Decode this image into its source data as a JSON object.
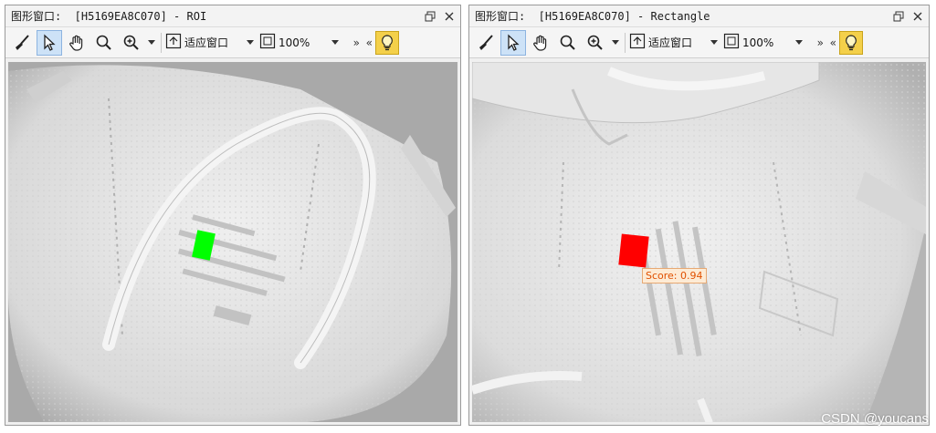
{
  "windows": [
    {
      "title": "图形窗口:  [H5169EA8C070] - ROI",
      "toolbar": {
        "fit_label": "适应窗口",
        "zoom_label": "100%"
      },
      "roi": {
        "color": "#00ff00"
      }
    },
    {
      "title": "图形窗口:  [H5169EA8C070] - Rectangle",
      "toolbar": {
        "fit_label": "适应窗口",
        "zoom_label": "100%"
      },
      "roi": {
        "color": "#ff0000"
      },
      "score_label": "Score: 0.94"
    }
  ],
  "icons": {
    "restore": "restore-icon",
    "close": "close-icon",
    "broom": "broom-icon",
    "pointer": "pointer-icon",
    "hand": "hand-icon",
    "search": "search-icon",
    "zoom_in": "zoom-in-icon",
    "fit": "fit-window-icon",
    "zoom_box": "zoom-percent-icon",
    "bulb": "lightbulb-icon"
  },
  "overflow_glyphs": {
    "more": "»",
    "less": "«"
  },
  "watermark": "CSDN @youcans",
  "colors": {
    "accent_active": "#cde2f7",
    "bulb": "#f4d04a",
    "score_text": "#e05000"
  }
}
